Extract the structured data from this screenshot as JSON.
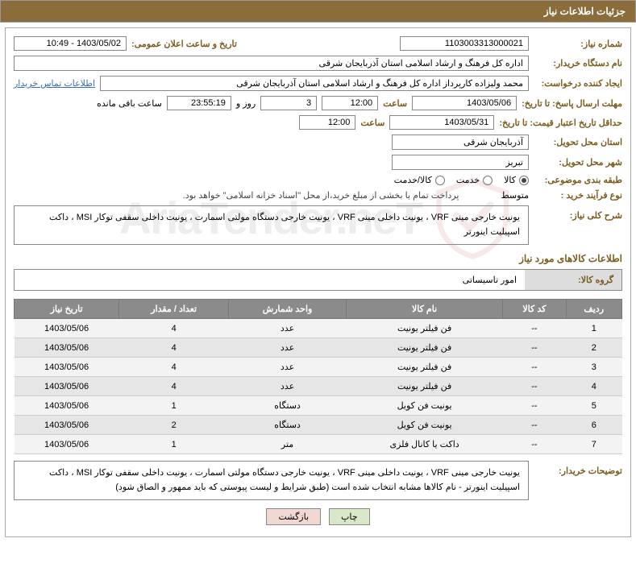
{
  "header": {
    "title": "جزئیات اطلاعات نیاز"
  },
  "fields": {
    "need_no_label": "شماره نیاز:",
    "need_no": "1103003313000021",
    "announce_label": "تاریخ و ساعت اعلان عمومی:",
    "announce_value": "1403/05/02 - 10:49",
    "buyer_org_label": "نام دستگاه خریدار:",
    "buyer_org": "اداره کل فرهنگ و ارشاد اسلامی استان آذربایجان شرقی",
    "requester_label": "ایجاد کننده درخواست:",
    "requester": "محمد ولیزاده کارپرداز اداره کل فرهنگ و ارشاد اسلامی استان آذربایجان شرقی",
    "buyer_contact_link": "اطلاعات تماس خریدار",
    "deadline_label": "مهلت ارسال پاسخ: تا تاریخ:",
    "deadline_date": "1403/05/06",
    "time_label": "ساعت",
    "deadline_time": "12:00",
    "days_remaining": "3",
    "days_word": "روز و",
    "countdown": "23:55:19",
    "countdown_suffix": "ساعت باقی مانده",
    "validity_label": "حداقل تاریخ اعتبار قیمت: تا تاریخ:",
    "validity_date": "1403/05/31",
    "validity_time": "12:00",
    "province_label": "استان محل تحویل:",
    "province": "آذربایجان شرقی",
    "city_label": "شهر محل تحویل:",
    "city": "تبریز",
    "category_label": "طبقه بندی موضوعی:",
    "radio_goods": "کالا",
    "radio_service": "خدمت",
    "radio_both": "کالا/خدمت",
    "process_label": "نوع فرآیند خرید :",
    "process_value": "متوسط",
    "payment_note": "پرداخت تمام یا بخشی از مبلغ خرید،از محل \"اسناد خزانه اسلامی\" خواهد بود.",
    "overview_label": "شرح کلی نیاز:",
    "overview_text": "یونیت خارجی مینی VRF ، یونیت داخلی مینی VRF ، یونیت خارجی دستگاه مولتی اسمارت ، یونیت داخلی سقفی توکار MSI ، داکت اسپیلیت اینورتر",
    "items_section": "اطلاعات کالاهای مورد نیاز",
    "group_label": "گروه کالا:",
    "group_value": "امور تاسیساتی",
    "buyer_notes_label": "توضیحات خریدار:",
    "buyer_notes": "یونیت خارجی مینی VRF ، یونیت داخلی مینی VRF ، یونیت خارجی دستگاه مولتی اسمارت ، یونیت داخلی سقفی توکار MSI ، داکت اسپیلیت اینورتر - نام کالاها مشابه انتخاب شده است (طبق شرایط و لیست پیوستی که باید ممهور و الصاق شود)"
  },
  "table": {
    "headers": [
      "ردیف",
      "کد کالا",
      "نام کالا",
      "واحد شمارش",
      "تعداد / مقدار",
      "تاریخ نیاز"
    ],
    "rows": [
      {
        "n": "1",
        "code": "--",
        "name": "فن فیلتر یونیت",
        "unit": "عدد",
        "qty": "4",
        "date": "1403/05/06"
      },
      {
        "n": "2",
        "code": "--",
        "name": "فن فیلتر یونیت",
        "unit": "عدد",
        "qty": "4",
        "date": "1403/05/06"
      },
      {
        "n": "3",
        "code": "--",
        "name": "فن فیلتر یونیت",
        "unit": "عدد",
        "qty": "4",
        "date": "1403/05/06"
      },
      {
        "n": "4",
        "code": "--",
        "name": "فن فیلتر یونیت",
        "unit": "عدد",
        "qty": "4",
        "date": "1403/05/06"
      },
      {
        "n": "5",
        "code": "--",
        "name": "یونیت فن کویل",
        "unit": "دستگاه",
        "qty": "1",
        "date": "1403/05/06"
      },
      {
        "n": "6",
        "code": "--",
        "name": "یونیت فن کویل",
        "unit": "دستگاه",
        "qty": "2",
        "date": "1403/05/06"
      },
      {
        "n": "7",
        "code": "--",
        "name": "داکت یا کانال فلزی",
        "unit": "متر",
        "qty": "1",
        "date": "1403/05/06"
      }
    ]
  },
  "buttons": {
    "print": "چاپ",
    "back": "بازگشت"
  },
  "watermark": "AriaTender.neT"
}
